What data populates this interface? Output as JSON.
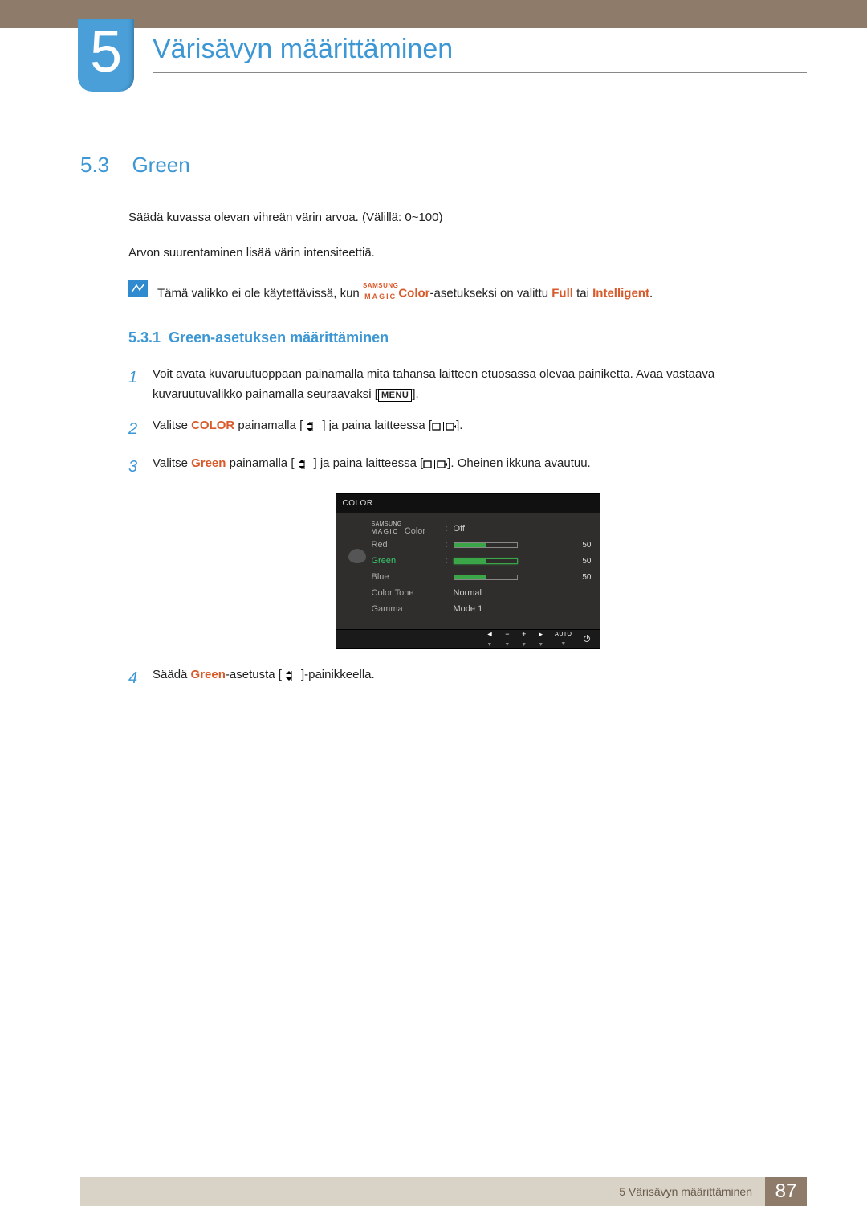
{
  "chapter": {
    "number": "5",
    "title": "Värisävyn määrittäminen"
  },
  "section": {
    "number": "5.3",
    "title": "Green",
    "intro1": "Säädä kuvassa olevan vihreän värin arvoa. (Välillä: 0~100)",
    "intro2": "Arvon suurentaminen lisää värin intensiteettiä.",
    "note_before": "Tämä valikko ei ole käytettävissä, kun ",
    "note_samsung": "SAMSUNG",
    "note_magic": "MAGIC",
    "note_color": "Color",
    "note_mid": "-asetukseksi on valittu ",
    "note_full": "Full",
    "note_or": " tai ",
    "note_intelligent": "Intelligent",
    "note_end": "."
  },
  "subsection": {
    "number": "5.3.1",
    "title": "Green-asetuksen määrittäminen"
  },
  "steps": {
    "s1a": "Voit avata kuvaruutuoppaan painamalla mitä tahansa laitteen etuosassa olevaa painiketta. Avaa vastaava kuvaruutuvalikko painamalla seuraavaksi [",
    "s1b": "].",
    "menu": "MENU",
    "s2a": "Valitse ",
    "s2_color": "COLOR",
    "s2b": " painamalla [",
    "s2c": "] ja paina laitteessa [",
    "s2d": "].",
    "s3a": "Valitse ",
    "s3_green": "Green",
    "s3b": " painamalla [",
    "s3c": "] ja paina laitteessa [",
    "s3d": "]. Oheinen ikkuna avautuu.",
    "s4a": "Säädä ",
    "s4_green": "Green",
    "s4b": "-asetusta [",
    "s4c": "]-painikkeella."
  },
  "osd": {
    "title": "COLOR",
    "magic_s": "SAMSUNG",
    "magic_m": "MAGIC",
    "magic_color": " Color",
    "off": "Off",
    "red": "Red",
    "red_val": "50",
    "green": "Green",
    "green_val": "50",
    "blue": "Blue",
    "blue_val": "50",
    "tone": "Color Tone",
    "tone_val": "Normal",
    "gamma": "Gamma",
    "gamma_val": "Mode 1",
    "auto": "AUTO"
  },
  "footer": {
    "text": "5 Värisävyn määrittäminen",
    "page": "87"
  }
}
